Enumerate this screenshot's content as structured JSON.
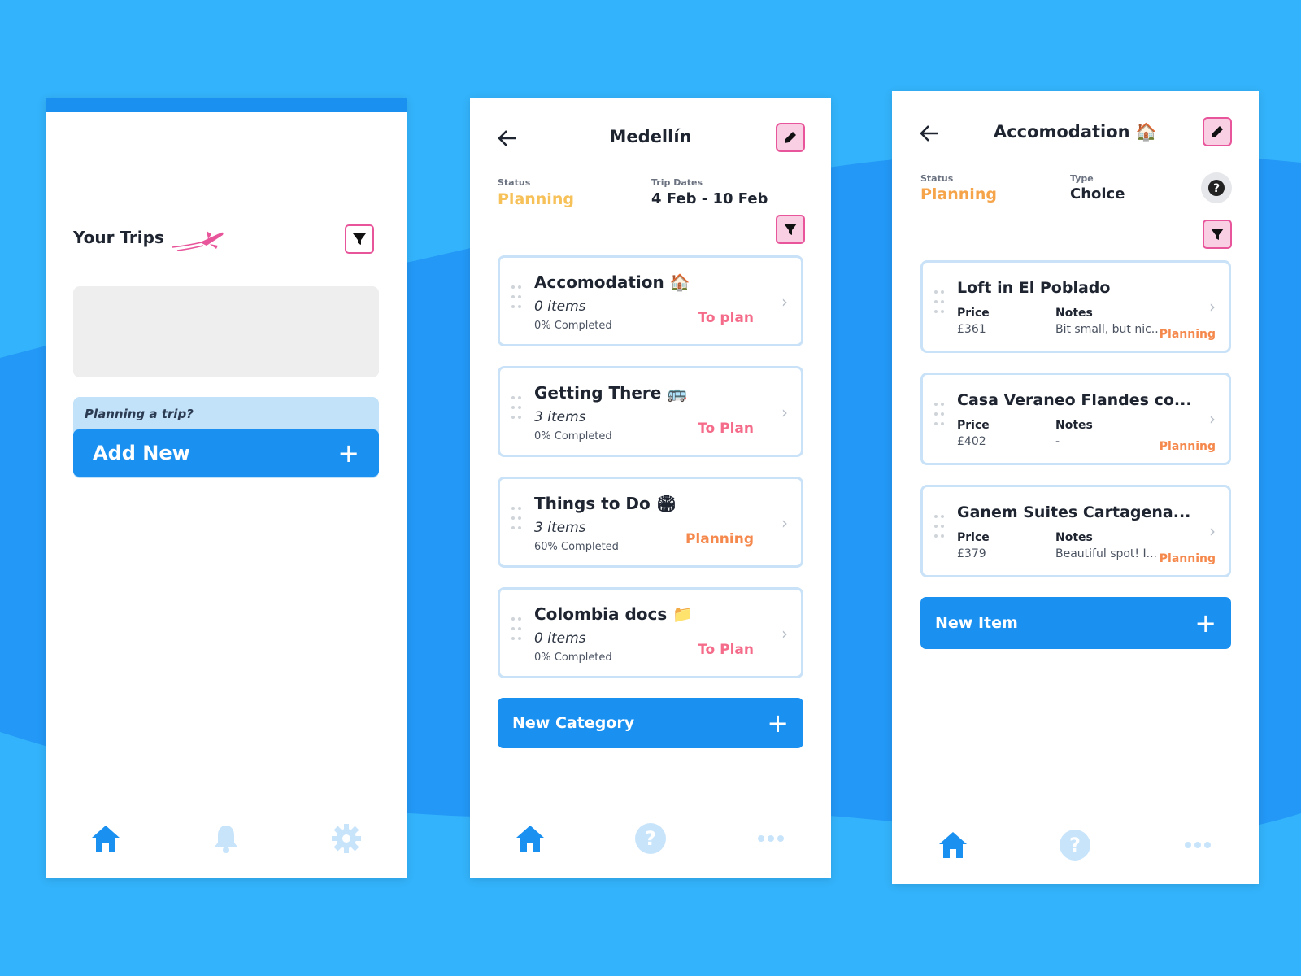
{
  "colors": {
    "background": "#33b3fb",
    "accent_blue": "#1a90f0",
    "pink": "#e8559a",
    "status_orange": "#f5894d",
    "status_pink": "#f56b8a"
  },
  "screen1": {
    "title": "Your Trips",
    "filter_icon": "filter-icon",
    "banner_text": "Planning a trip?",
    "add_new_label": "Add New",
    "add_icon": "+",
    "nav": [
      "home-icon",
      "bell-icon",
      "gear-icon"
    ]
  },
  "screen2": {
    "title": "Medellín",
    "status_label": "Status",
    "status_value": "Planning",
    "dates_label": "Trip Dates",
    "dates_value": "4 Feb - 10 Feb",
    "categories": [
      {
        "title": "Accomodation 🏠",
        "items": "0 items",
        "completed": "0% Completed",
        "status": "To plan"
      },
      {
        "title": "Getting There 🚌",
        "items": "3 items",
        "completed": "0% Completed",
        "status": "To Plan"
      },
      {
        "title": "Things to Do 🏟",
        "items": "3 items",
        "completed": "60% Completed",
        "status": "Planning"
      },
      {
        "title": "Colombia docs 📁",
        "items": "0 items",
        "completed": "0% Completed",
        "status": "To Plan"
      }
    ],
    "new_category_label": "New Category",
    "add_icon": "+",
    "nav": [
      "home-icon",
      "help-icon",
      "more-icon"
    ]
  },
  "screen3": {
    "title": "Accomodation 🏠",
    "status_label": "Status",
    "status_value": "Planning",
    "type_label": "Type",
    "type_value": "Choice",
    "items": [
      {
        "title": "Loft in El Poblado",
        "price_label": "Price",
        "price": "£361",
        "notes_label": "Notes",
        "notes": "Bit small, but nic...",
        "status": "Planning"
      },
      {
        "title": "Casa Veraneo Flandes co...",
        "price_label": "Price",
        "price": "£402",
        "notes_label": "Notes",
        "notes": "-",
        "status": "Planning"
      },
      {
        "title": "Ganem Suites Cartagena...",
        "price_label": "Price",
        "price": "£379",
        "notes_label": "Notes",
        "notes": "Beautiful spot! I...",
        "status": "Planning"
      }
    ],
    "new_item_label": "New Item",
    "add_icon": "+",
    "nav": [
      "home-icon",
      "help-icon",
      "more-icon"
    ]
  }
}
